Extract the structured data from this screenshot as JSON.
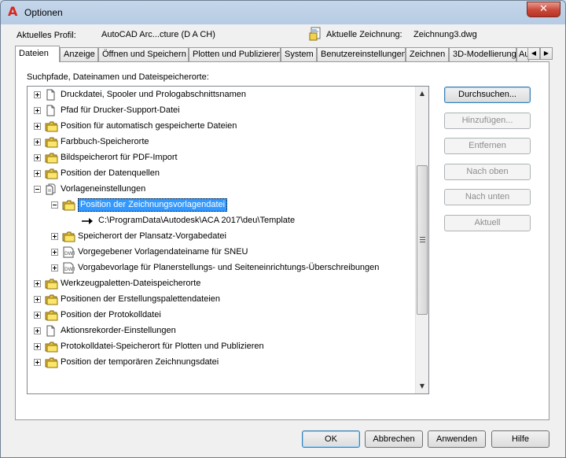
{
  "window": {
    "title": "Optionen",
    "close_glyph": "✕",
    "app_icon_glyph": "A"
  },
  "profile": {
    "label": "Aktuelles Profil:",
    "value": "AutoCAD Arc...cture (D A CH)"
  },
  "drawing": {
    "label": "Aktuelle Zeichnung:",
    "value": "Zeichnung3.dwg"
  },
  "tabs": [
    {
      "label": "Dateien"
    },
    {
      "label": "Anzeige"
    },
    {
      "label": "Öffnen und Speichern"
    },
    {
      "label": "Plotten und Publizieren"
    },
    {
      "label": "System"
    },
    {
      "label": "Benutzereinstellungen"
    },
    {
      "label": "Zeichnen"
    },
    {
      "label": "3D-Modellierung"
    },
    {
      "label": "Au"
    }
  ],
  "tab_scroll": {
    "left": "◀",
    "right": "▶"
  },
  "section_label": "Suchpfade, Dateinamen und Dateispeicherorte:",
  "tree": [
    {
      "label": "Druckdatei, Spooler und Prologabschnittsnamen",
      "icon": "document-icon",
      "expander": "plus"
    },
    {
      "label": "Pfad für Drucker-Support-Datei",
      "icon": "document-icon",
      "expander": "plus"
    },
    {
      "label": "Position für automatisch gespeicherte Dateien",
      "icon": "folder-icon",
      "expander": "plus"
    },
    {
      "label": "Farbbuch-Speicherorte",
      "icon": "folder-icon",
      "expander": "plus"
    },
    {
      "label": "Bildspeicherort für PDF-Import",
      "icon": "folder-icon",
      "expander": "plus"
    },
    {
      "label": "Position der Datenquellen",
      "icon": "folder-icon",
      "expander": "plus"
    },
    {
      "label": "Vorlageneinstellungen",
      "icon": "documents-icon",
      "expander": "minus"
    },
    {
      "label": "Position der Zeichnungsvorlagendatei",
      "icon": "folder-icon",
      "expander": "minus",
      "selected": true
    },
    {
      "label": "C:\\ProgramData\\Autodesk\\ACA 2017\\deu\\Template",
      "icon": "arrow-icon",
      "expander": "none"
    },
    {
      "label": "Speicherort der Plansatz-Vorgabedatei",
      "icon": "folder-icon",
      "expander": "plus"
    },
    {
      "label": "Vorgegebener Vorlagendateiname für SNEU",
      "icon": "dwt-file-icon",
      "expander": "plus"
    },
    {
      "label": "Vorgabevorlage für Planerstellungs- und Seiteneinrichtungs-Überschreibungen",
      "icon": "dwt-file-icon",
      "expander": "plus"
    },
    {
      "label": "Werkzeugpaletten-Dateispeicherorte",
      "icon": "folder-icon",
      "expander": "plus"
    },
    {
      "label": "Positionen der Erstellungspalettendateien",
      "icon": "folder-icon",
      "expander": "plus"
    },
    {
      "label": "Position der Protokolldatei",
      "icon": "folder-icon",
      "expander": "plus"
    },
    {
      "label": "Aktionsrekorder-Einstellungen",
      "icon": "document-icon",
      "expander": "plus"
    },
    {
      "label": "Protokolldatei-Speicherort für Plotten und Publizieren",
      "icon": "folder-icon",
      "expander": "plus"
    },
    {
      "label": "Position der temporären Zeichnungsdatei",
      "icon": "folder-icon",
      "expander": "plus"
    }
  ],
  "side_buttons": {
    "browse": "Durchsuchen...",
    "add": "Hinzufügen...",
    "remove": "Entfernen",
    "move_up": "Nach oben",
    "move_down": "Nach unten",
    "current": "Aktuell"
  },
  "scrollbar": {
    "up": "▲",
    "down": "▼"
  },
  "bottom_buttons": {
    "ok": "OK",
    "cancel": "Abbrechen",
    "apply": "Anwenden",
    "help": "Hilfe"
  }
}
